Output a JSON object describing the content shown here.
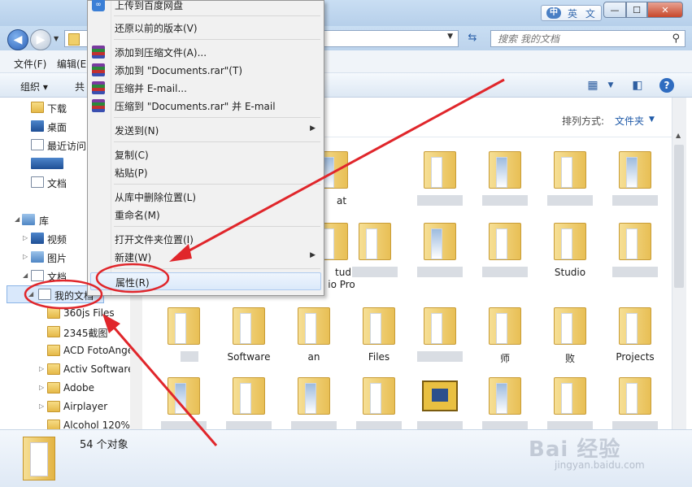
{
  "window": {
    "ime_label": "英 文",
    "ime_logo": "中",
    "min_glyph": "—",
    "max_glyph": "☐",
    "close_glyph": "✕"
  },
  "address": {
    "back_glyph": "◀",
    "forward_glyph": "▶",
    "search_placeholder": "搜索 我的文档"
  },
  "menubar": {
    "file": "文件(F)",
    "edit": "编辑(E"
  },
  "toolbar": {
    "organize": "组织 ▾",
    "share": "共"
  },
  "nav": {
    "downloads": "下载",
    "desktop": "桌面",
    "recent": "最近访问",
    "documents_fav": "文档",
    "libraries": "库",
    "videos": "视频",
    "pictures": "图片",
    "documents": "文档",
    "my_documents": "我的文档",
    "f_360js": "360js Files",
    "f_2345": "2345截图",
    "f_acd": "ACD FotoAngel",
    "f_activ": "Activ Software",
    "f_adobe": "Adobe",
    "f_airplayer": "Airplayer",
    "f_alcohol": "Alcohol 120%"
  },
  "content": {
    "sort_label": "排列方式:",
    "sort_value": "文件夹",
    "captions": {
      "r1c3": "at",
      "r2c3": "tud",
      "r2c3b": "io Pro",
      "r2c7": "Studio",
      "r3c2": "Software",
      "r3c3": "an",
      "r3c4": "Files",
      "r3c6": "师",
      "r3c7": "败",
      "r3c8": "Projects"
    }
  },
  "status": {
    "count_text": "54 个对象",
    "watermark": "Bai  经验",
    "watermark_sub": "jingyan.baidu.com"
  },
  "context_menu": {
    "upload": "上传到百度网盘",
    "restore": "还原以前的版本(V)",
    "add_archive": "添加到压缩文件(A)...",
    "add_documents_rar": "添加到 \"Documents.rar\"(T)",
    "compress_email": "压缩并 E-mail...",
    "compress_documents_email": "压缩到 \"Documents.rar\" 并 E-mail",
    "send_to": "发送到(N)",
    "copy": "复制(C)",
    "paste": "粘贴(P)",
    "remove_from_library": "从库中删除位置(L)",
    "rename": "重命名(M)",
    "open_location": "打开文件夹位置(I)",
    "new": "新建(W)",
    "properties": "属性(R)"
  },
  "colors": {
    "annotation": "#e0262b",
    "accent_blue": "#1f5aa8"
  }
}
